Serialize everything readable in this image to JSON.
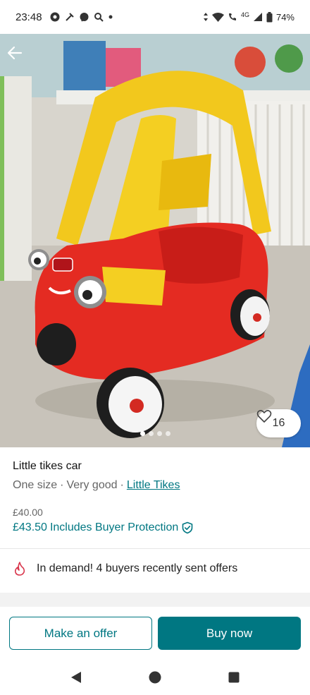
{
  "status_bar": {
    "time": "23:48",
    "network": "4G",
    "battery": "74%"
  },
  "product": {
    "title": "Little tikes car",
    "size": "One size",
    "condition": "Very good",
    "separator": "·",
    "brand": "Little Tikes",
    "price": "£40.00",
    "total_price": "£43.50",
    "protection_label": "Includes Buyer Protection",
    "favourites": "16",
    "image_count": 4,
    "active_image": 1
  },
  "demand": {
    "text": "In demand! 4 buyers recently sent offers"
  },
  "actions": {
    "offer_label": "Make an offer",
    "buy_label": "Buy now"
  },
  "colors": {
    "accent": "#007782",
    "demand_icon": "#d9364c"
  },
  "icons": {
    "back": "arrow-left-icon",
    "favourite": "heart-outline-icon",
    "protection": "shield-check-icon",
    "demand": "flame-icon",
    "nav_back": "triangle-back-icon",
    "nav_home": "circle-home-icon",
    "nav_recents": "square-recents-icon"
  }
}
